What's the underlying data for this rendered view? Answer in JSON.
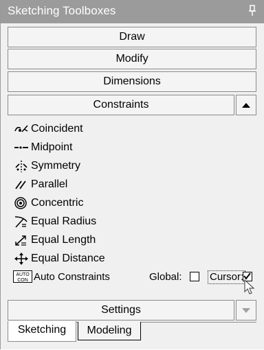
{
  "titlebar": {
    "title": "Sketching Toolboxes",
    "pin_icon": "pin-icon"
  },
  "sections": {
    "draw": "Draw",
    "modify": "Modify",
    "dimensions": "Dimensions",
    "constraints": "Constraints",
    "settings": "Settings"
  },
  "constraints": [
    {
      "label": "Coincident",
      "icon": "coincident-icon"
    },
    {
      "label": "Midpoint",
      "icon": "midpoint-icon"
    },
    {
      "label": "Symmetry",
      "icon": "symmetry-icon"
    },
    {
      "label": "Parallel",
      "icon": "parallel-icon"
    },
    {
      "label": "Concentric",
      "icon": "concentric-icon"
    },
    {
      "label": "Equal Radius",
      "icon": "equal-radius-icon"
    },
    {
      "label": "Equal Length",
      "icon": "equal-length-icon"
    },
    {
      "label": "Equal Distance",
      "icon": "equal-distance-icon"
    }
  ],
  "auto_constraints": {
    "label": "Auto Constraints",
    "global_label": "Global:",
    "global_checked": false,
    "cursor_label": "Cursor:",
    "cursor_checked": true,
    "icon_text_top": "AUTO",
    "icon_text_bottom": "CON"
  },
  "tabs": [
    {
      "label": "Sketching",
      "active": true
    },
    {
      "label": "Modeling",
      "active": false
    }
  ]
}
